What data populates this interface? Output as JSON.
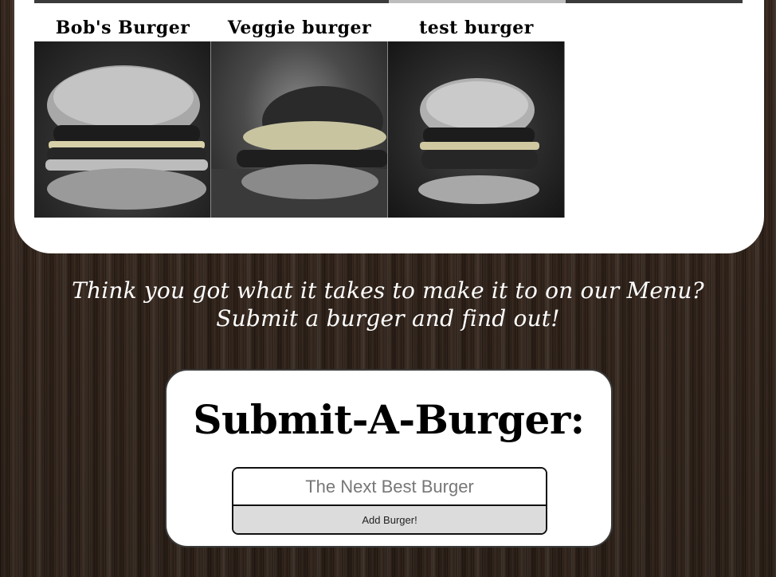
{
  "menu": {
    "burgers": [
      {
        "name": "Bob's Burger",
        "photo_icon": "burger-photo"
      },
      {
        "name": "Veggie burger",
        "photo_icon": "burger-photo"
      },
      {
        "name": "test burger",
        "photo_icon": "burger-photo"
      }
    ]
  },
  "cta": {
    "text": "Think you got what it takes to make it to on our Menu? Submit a burger and find out!"
  },
  "submit": {
    "title": "Submit-A-Burger:",
    "input_placeholder": "The Next Best Burger",
    "input_value": "",
    "button_label": "Add Burger!"
  },
  "colors": {
    "panel": "#ffffff",
    "wood": "#3a2a20",
    "button": "#dcdcdc"
  }
}
